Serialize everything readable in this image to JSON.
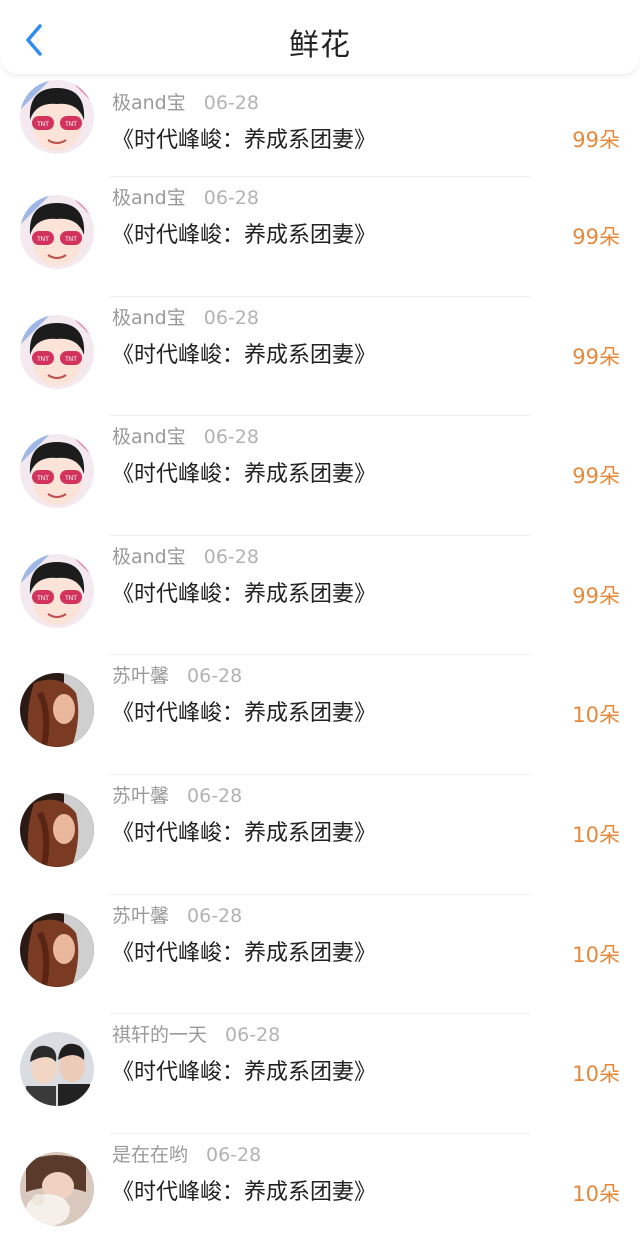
{
  "header": {
    "title": "鲜花"
  },
  "colors": {
    "accent": "#e8883a",
    "back": "#2f8cf0"
  },
  "items": [
    {
      "name": "极and宝",
      "date": "06-28",
      "book": "《时代峰峻：养成系团妻》",
      "amount": "99朵",
      "avatar": "tnt-cartoon"
    },
    {
      "name": "极and宝",
      "date": "06-28",
      "book": "《时代峰峻：养成系团妻》",
      "amount": "99朵",
      "avatar": "tnt-cartoon"
    },
    {
      "name": "极and宝",
      "date": "06-28",
      "book": "《时代峰峻：养成系团妻》",
      "amount": "99朵",
      "avatar": "tnt-cartoon"
    },
    {
      "name": "极and宝",
      "date": "06-28",
      "book": "《时代峰峻：养成系团妻》",
      "amount": "99朵",
      "avatar": "tnt-cartoon"
    },
    {
      "name": "极and宝",
      "date": "06-28",
      "book": "《时代峰峻：养成系团妻》",
      "amount": "99朵",
      "avatar": "tnt-cartoon"
    },
    {
      "name": "苏叶馨",
      "date": "06-28",
      "book": "《时代峰峻：养成系团妻》",
      "amount": "10朵",
      "avatar": "woman-photo"
    },
    {
      "name": "苏叶馨",
      "date": "06-28",
      "book": "《时代峰峻：养成系团妻》",
      "amount": "10朵",
      "avatar": "woman-photo"
    },
    {
      "name": "苏叶馨",
      "date": "06-28",
      "book": "《时代峰峻：养成系团妻》",
      "amount": "10朵",
      "avatar": "woman-photo"
    },
    {
      "name": "祺轩的一天",
      "date": "06-28",
      "book": "《时代峰峻：养成系团妻》",
      "amount": "10朵",
      "avatar": "two-boys-photo"
    },
    {
      "name": "是在在哟",
      "date": "06-28",
      "book": "《时代峰峻：养成系团妻》",
      "amount": "10朵",
      "avatar": "girl-plush-photo"
    }
  ]
}
